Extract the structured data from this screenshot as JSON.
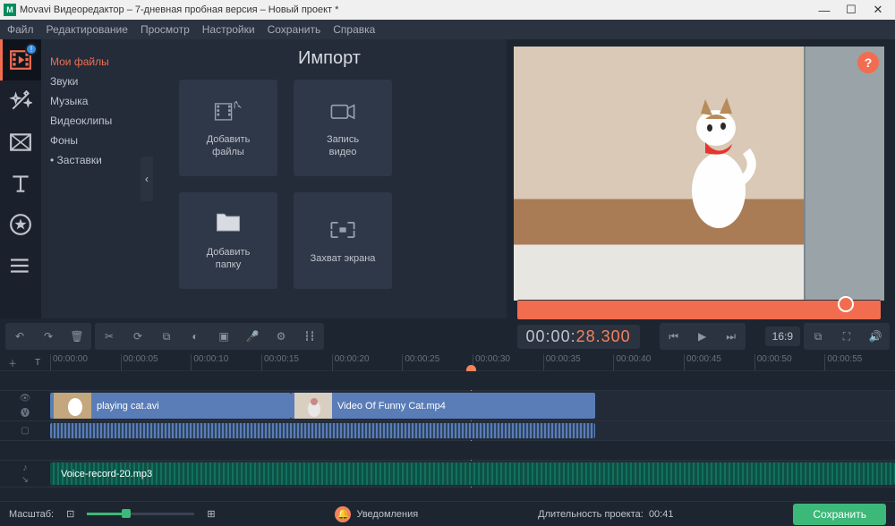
{
  "window": {
    "title": "Movavi Видеоредактор – 7-дневная пробная версия – Новый проект *"
  },
  "menubar": [
    "Файл",
    "Редактирование",
    "Просмотр",
    "Настройки",
    "Сохранить",
    "Справка"
  ],
  "sidebar_tools": [
    "import",
    "effects",
    "transitions",
    "titles",
    "stickers",
    "more"
  ],
  "import": {
    "title": "Импорт",
    "categories": [
      {
        "label": "Мои файлы",
        "active": true
      },
      {
        "label": "Звуки",
        "active": false
      },
      {
        "label": "Музыка",
        "active": false
      },
      {
        "label": "Видеоклипы",
        "active": false
      },
      {
        "label": "Фоны",
        "active": false
      },
      {
        "label": "• Заставки",
        "active": false
      }
    ],
    "tiles": [
      {
        "label": "Добавить\nфайлы",
        "icon": "add-files"
      },
      {
        "label": "Запись\nвидео",
        "icon": "record-video"
      },
      {
        "label": "Добавить\nпапку",
        "icon": "add-folder"
      },
      {
        "label": "Захват экрана",
        "icon": "screen-capture"
      }
    ]
  },
  "preview": {
    "timecode_prefix": "00:00:",
    "timecode_highlight": "28.300",
    "aspect_ratio": "16:9",
    "help": "?"
  },
  "ruler_ticks": [
    "00:00:00",
    "00:00:05",
    "00:00:10",
    "00:00:15",
    "00:00:20",
    "00:00:25",
    "00:00:30",
    "00:00:35",
    "00:00:40",
    "00:00:45",
    "00:00:50",
    "00:00:55"
  ],
  "timeline": {
    "video_clips": [
      {
        "label": "playing cat.avi",
        "start_pct": 0,
        "width_pct": 28.5
      },
      {
        "label": "Video Of Funny Cat.mp4",
        "start_pct": 28.5,
        "width_pct": 36
      }
    ],
    "audio_track_label": "Voice-record-20.mp3",
    "project_duration_label": "Длительность проекта:",
    "project_duration_value": "00:41"
  },
  "statusbar": {
    "zoom_label": "Масштаб:",
    "notifications_label": "Уведомления",
    "save_label": "Сохранить"
  }
}
